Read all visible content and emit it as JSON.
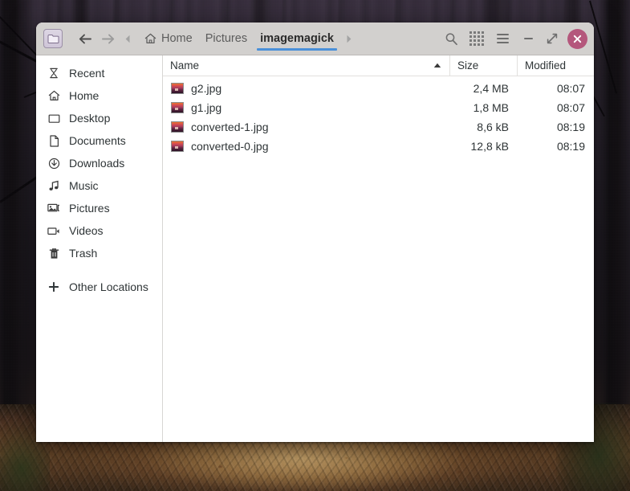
{
  "window": {
    "app_icon": "folder-icon",
    "nav": {
      "back": "back-arrow-icon",
      "forward": "forward-arrow-icon",
      "crumb_prev": "breadcrumb-left-chevron-icon",
      "crumb_next": "breadcrumb-right-chevron-icon"
    },
    "breadcrumbs": [
      {
        "label": "Home",
        "icon": "home-icon",
        "current": false
      },
      {
        "label": "Pictures",
        "icon": "",
        "current": false
      },
      {
        "label": "imagemagick",
        "icon": "",
        "current": true
      }
    ],
    "header_actions": [
      {
        "name": "search-button",
        "icon": "search-icon"
      },
      {
        "name": "view-options-button",
        "icon": "grid-dots-icon"
      },
      {
        "name": "main-menu-button",
        "icon": "hamburger-menu-icon"
      }
    ],
    "window_controls": [
      {
        "name": "minimize-button",
        "icon": "minimize-icon"
      },
      {
        "name": "maximize-button",
        "icon": "maximize-icon"
      },
      {
        "name": "close-button",
        "icon": "close-icon"
      }
    ],
    "accent_color": "#4a90d9",
    "close_color": "#b4577c"
  },
  "sidebar": {
    "items": [
      {
        "label": "Recent",
        "icon": "clock-history-icon"
      },
      {
        "label": "Home",
        "icon": "home-icon"
      },
      {
        "label": "Desktop",
        "icon": "desktop-icon"
      },
      {
        "label": "Documents",
        "icon": "document-icon"
      },
      {
        "label": "Downloads",
        "icon": "download-icon"
      },
      {
        "label": "Music",
        "icon": "music-note-icon"
      },
      {
        "label": "Pictures",
        "icon": "picture-icon"
      },
      {
        "label": "Videos",
        "icon": "video-camera-icon"
      },
      {
        "label": "Trash",
        "icon": "trash-icon"
      }
    ],
    "other_locations": {
      "label": "Other Locations",
      "icon": "plus-icon"
    }
  },
  "file_list": {
    "columns": {
      "name": "Name",
      "size": "Size",
      "modified": "Modified"
    },
    "sort": {
      "column": "Name",
      "direction": "ascending",
      "icon": "sort-ascending-icon"
    },
    "rows": [
      {
        "name": "g2.jpg",
        "size": "2,4 MB",
        "modified": "08:07",
        "icon": "jpeg-thumbnail-icon"
      },
      {
        "name": "g1.jpg",
        "size": "1,8 MB",
        "modified": "08:07",
        "icon": "jpeg-thumbnail-icon"
      },
      {
        "name": "converted-1.jpg",
        "size": "8,6 kB",
        "modified": "08:19",
        "icon": "jpeg-thumbnail-icon"
      },
      {
        "name": "converted-0.jpg",
        "size": "12,8 kB",
        "modified": "08:19",
        "icon": "jpeg-thumbnail-icon"
      }
    ]
  }
}
